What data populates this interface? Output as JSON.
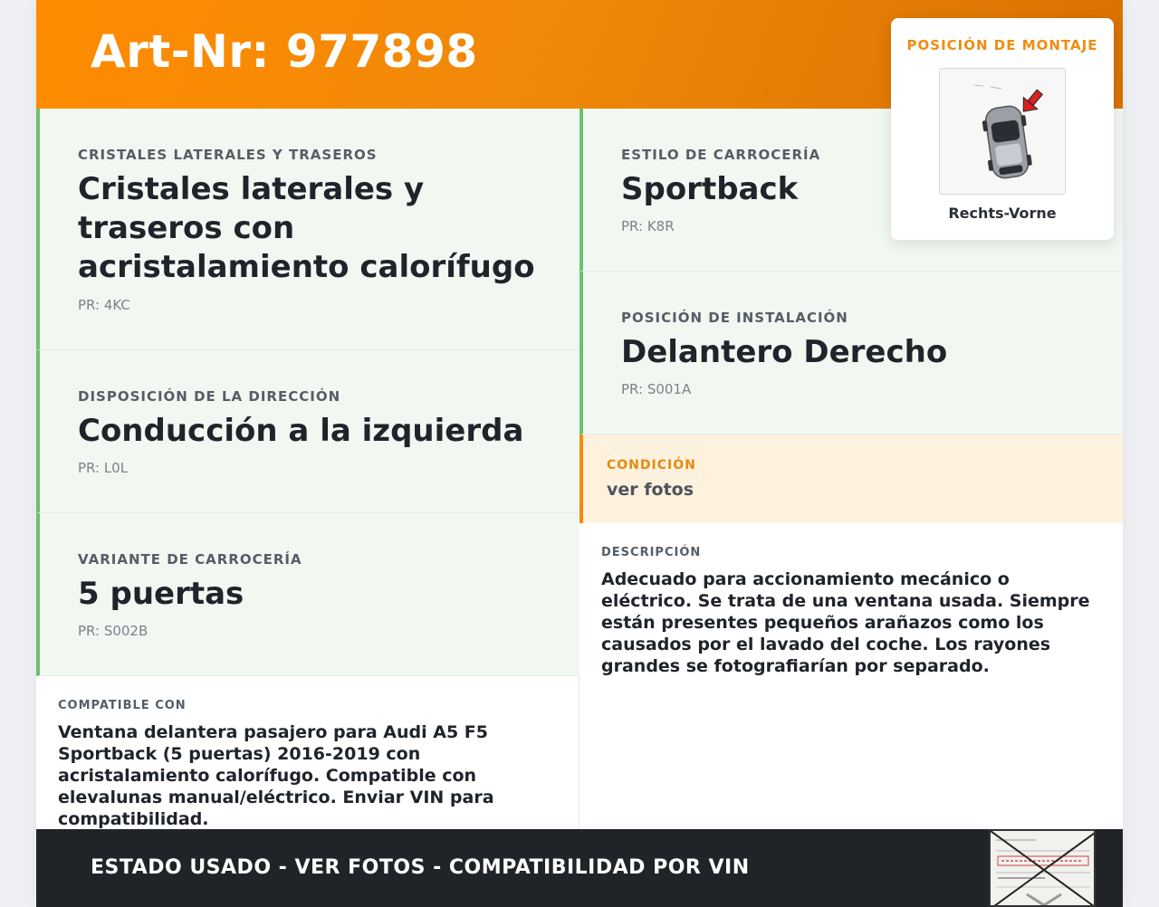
{
  "header": {
    "title": "Art-Nr: 977898"
  },
  "left_cells": [
    {
      "label": "CRISTALES LATERALES Y TRASEROS",
      "value": "Cristales laterales y traseros con acristalamiento calorífugo",
      "pr": "PR: 4KC"
    },
    {
      "label": "DISPOSICIÓN DE LA DIRECCIÓN",
      "value": "Conducción a la izquierda",
      "pr": "PR: L0L"
    },
    {
      "label": "VARIANTE DE CARROCERÍA",
      "value": "5 puertas",
      "pr": "PR: S002B"
    }
  ],
  "right_cells": [
    {
      "label": "ESTILO DE CARROCERÍA",
      "value": "Sportback",
      "pr": "PR: K8R"
    },
    {
      "label": "POSICIÓN DE INSTALACIÓN",
      "value": "Delantero Derecho",
      "pr": "PR: S001A"
    }
  ],
  "condition": {
    "label": "CONDICIÓN",
    "value": "ver fotos"
  },
  "compatible": {
    "label": "COMPATIBLE CON",
    "text": "Ventana delantera pasajero para Audi A5 F5 Sportback (5 puertas) 2016-2019 con acristalamiento calorífugo. Compatible con elevalunas manual/eléctrico. Enviar VIN para compatibilidad."
  },
  "description": {
    "label": "DESCRIPCIÓN",
    "text": "Adecuado para accionamiento mecánico o eléctrico. Se trata de una ventana usada. Siempre están presentes pequeños arañazos como los causados por el lavado del coche. Los rayones grandes se fotografiarían por separado."
  },
  "mount_position": {
    "title": "POSICIÓN DE MONTAJE",
    "caption": "Rechts-Vorne",
    "image_icon": "car-top-view-icon"
  },
  "footer": {
    "text": "ESTADO USADO - VER FOTOS - COMPATIBILIDAD POR VIN",
    "thumb_icon": "vehicle-document-icon"
  },
  "colors": {
    "accent": "#ff8c00",
    "green_border": "#6cc070",
    "cell_bg": "#f1f8f2",
    "condition_bg": "#fef1de",
    "footer_bg": "#202429"
  }
}
